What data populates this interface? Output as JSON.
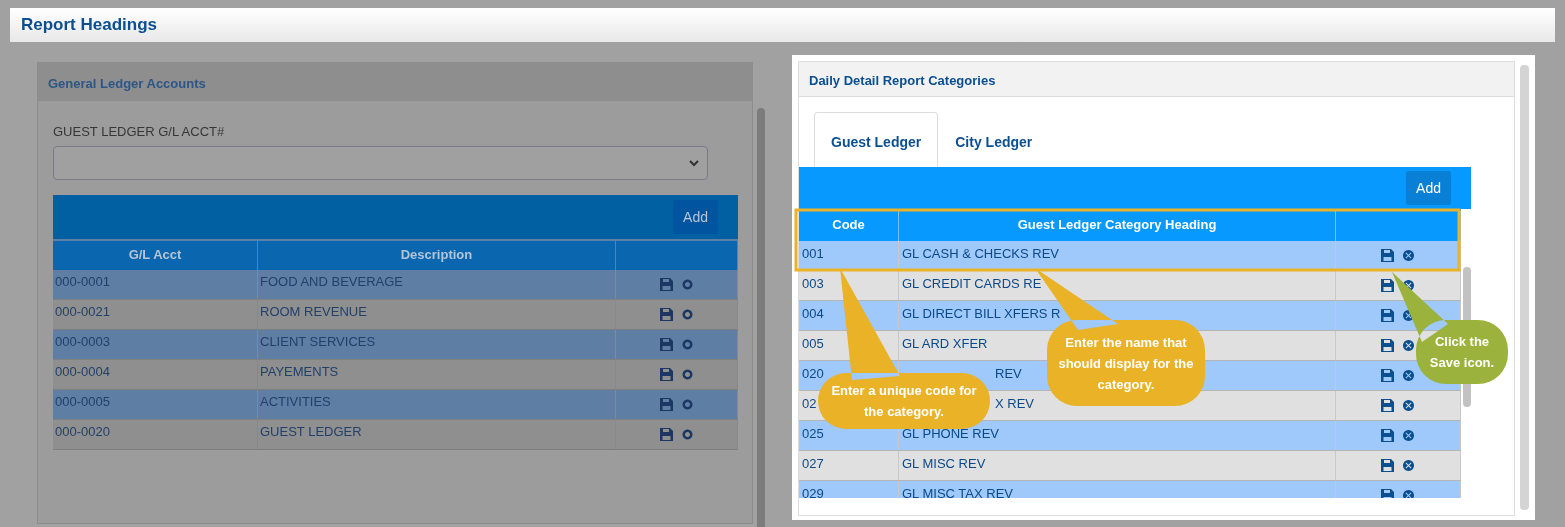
{
  "page_title": "Report Headings",
  "gl_panel": {
    "title": "General Ledger Accounts",
    "field_label": "GUEST LEDGER G/L ACCT#",
    "add_button": "Add",
    "columns": [
      "G/L Acct",
      "Description"
    ],
    "rows": [
      {
        "acct": "000-0001",
        "description": "FOOD AND BEVERAGE"
      },
      {
        "acct": "000-0021",
        "description": "ROOM REVENUE"
      },
      {
        "acct": "000-0003",
        "description": "CLIENT SERVICES"
      },
      {
        "acct": "000-0004",
        "description": "PAYEMENTS"
      },
      {
        "acct": "000-0005",
        "description": "ACTIVITIES"
      },
      {
        "acct": "000-0020",
        "description": "GUEST LEDGER"
      }
    ]
  },
  "category_panel": {
    "title": "Daily Detail Report Categories",
    "tabs": [
      {
        "label": "Guest Ledger",
        "selected": true
      },
      {
        "label": "City Ledger",
        "selected": false
      }
    ],
    "add_button": "Add",
    "columns": [
      "Code",
      "Guest Ledger Category Heading"
    ],
    "rows": [
      {
        "kind": "plain",
        "code": "001",
        "heading": "GL CASH & CHECKS REV"
      },
      {
        "kind": "plain",
        "code": "003",
        "heading": "GL CREDIT CARDS RE"
      },
      {
        "kind": "plain",
        "code": "004",
        "heading": "GL DIRECT BILL XFERS R"
      },
      {
        "kind": "plain",
        "code": "005",
        "heading": "GL ARD XFER"
      },
      {
        "kind": "covered",
        "code": "020",
        "heading": "REV"
      },
      {
        "kind": "covered",
        "code": "02",
        "heading": "X REV"
      },
      {
        "kind": "plain",
        "code": "025",
        "heading": "GL PHONE REV"
      },
      {
        "kind": "plain",
        "code": "027",
        "heading": "GL MISC REV"
      },
      {
        "kind": "plain",
        "code": "029",
        "heading": "GL MISC TAX REV"
      }
    ]
  },
  "callouts": [
    {
      "text": "Enter a unique code for the category.",
      "color": "#e9b227"
    },
    {
      "text": "Enter the name that should display for the category.",
      "color": "#e9b227"
    },
    {
      "text": "Click the Save icon.",
      "color": "#9bb33c"
    }
  ]
}
